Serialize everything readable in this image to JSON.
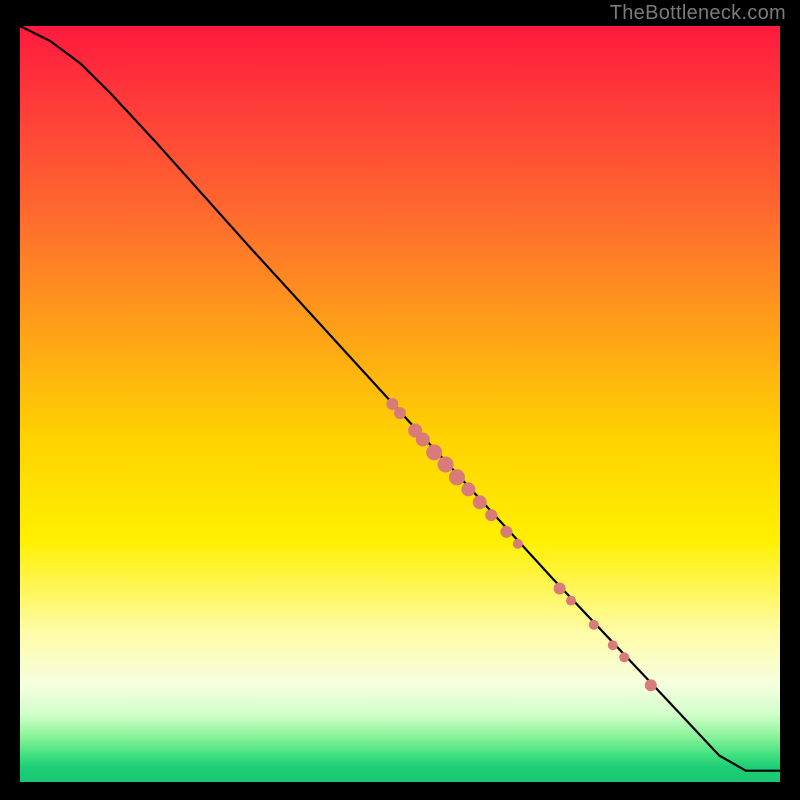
{
  "watermark": "TheBottleneck.com",
  "colors": {
    "dot": "#d97b78",
    "line": "#000000",
    "gradient_top": "#ff1a3e",
    "gradient_bottom": "#19c873"
  },
  "chart_data": {
    "type": "line",
    "title": "",
    "xlabel": "",
    "ylabel": "",
    "xlim": [
      0,
      100
    ],
    "ylim": [
      0,
      100
    ],
    "line_points": [
      {
        "x": 0,
        "y": 100
      },
      {
        "x": 4,
        "y": 98
      },
      {
        "x": 8,
        "y": 95
      },
      {
        "x": 12,
        "y": 91
      },
      {
        "x": 18,
        "y": 84.5
      },
      {
        "x": 30,
        "y": 71
      },
      {
        "x": 50,
        "y": 49
      },
      {
        "x": 70,
        "y": 27
      },
      {
        "x": 85,
        "y": 11
      },
      {
        "x": 92,
        "y": 3.5
      },
      {
        "x": 95.5,
        "y": 1.5
      },
      {
        "x": 100,
        "y": 1.5
      }
    ],
    "dots": [
      {
        "x": 49,
        "y": 50,
        "r": 6
      },
      {
        "x": 50,
        "y": 48.8,
        "r": 6
      },
      {
        "x": 52,
        "y": 46.5,
        "r": 7
      },
      {
        "x": 53,
        "y": 45.3,
        "r": 7
      },
      {
        "x": 54.5,
        "y": 43.6,
        "r": 8
      },
      {
        "x": 56,
        "y": 42,
        "r": 8
      },
      {
        "x": 57.5,
        "y": 40.3,
        "r": 8
      },
      {
        "x": 59,
        "y": 38.7,
        "r": 7
      },
      {
        "x": 60.5,
        "y": 37,
        "r": 7
      },
      {
        "x": 62,
        "y": 35.3,
        "r": 6
      },
      {
        "x": 64,
        "y": 33.1,
        "r": 6
      },
      {
        "x": 65.5,
        "y": 31.5,
        "r": 5
      },
      {
        "x": 71,
        "y": 25.6,
        "r": 6
      },
      {
        "x": 72.5,
        "y": 24,
        "r": 5
      },
      {
        "x": 75.5,
        "y": 20.8,
        "r": 5
      },
      {
        "x": 78,
        "y": 18.1,
        "r": 5
      },
      {
        "x": 79.5,
        "y": 16.5,
        "r": 5
      },
      {
        "x": 83,
        "y": 12.8,
        "r": 6
      }
    ]
  }
}
